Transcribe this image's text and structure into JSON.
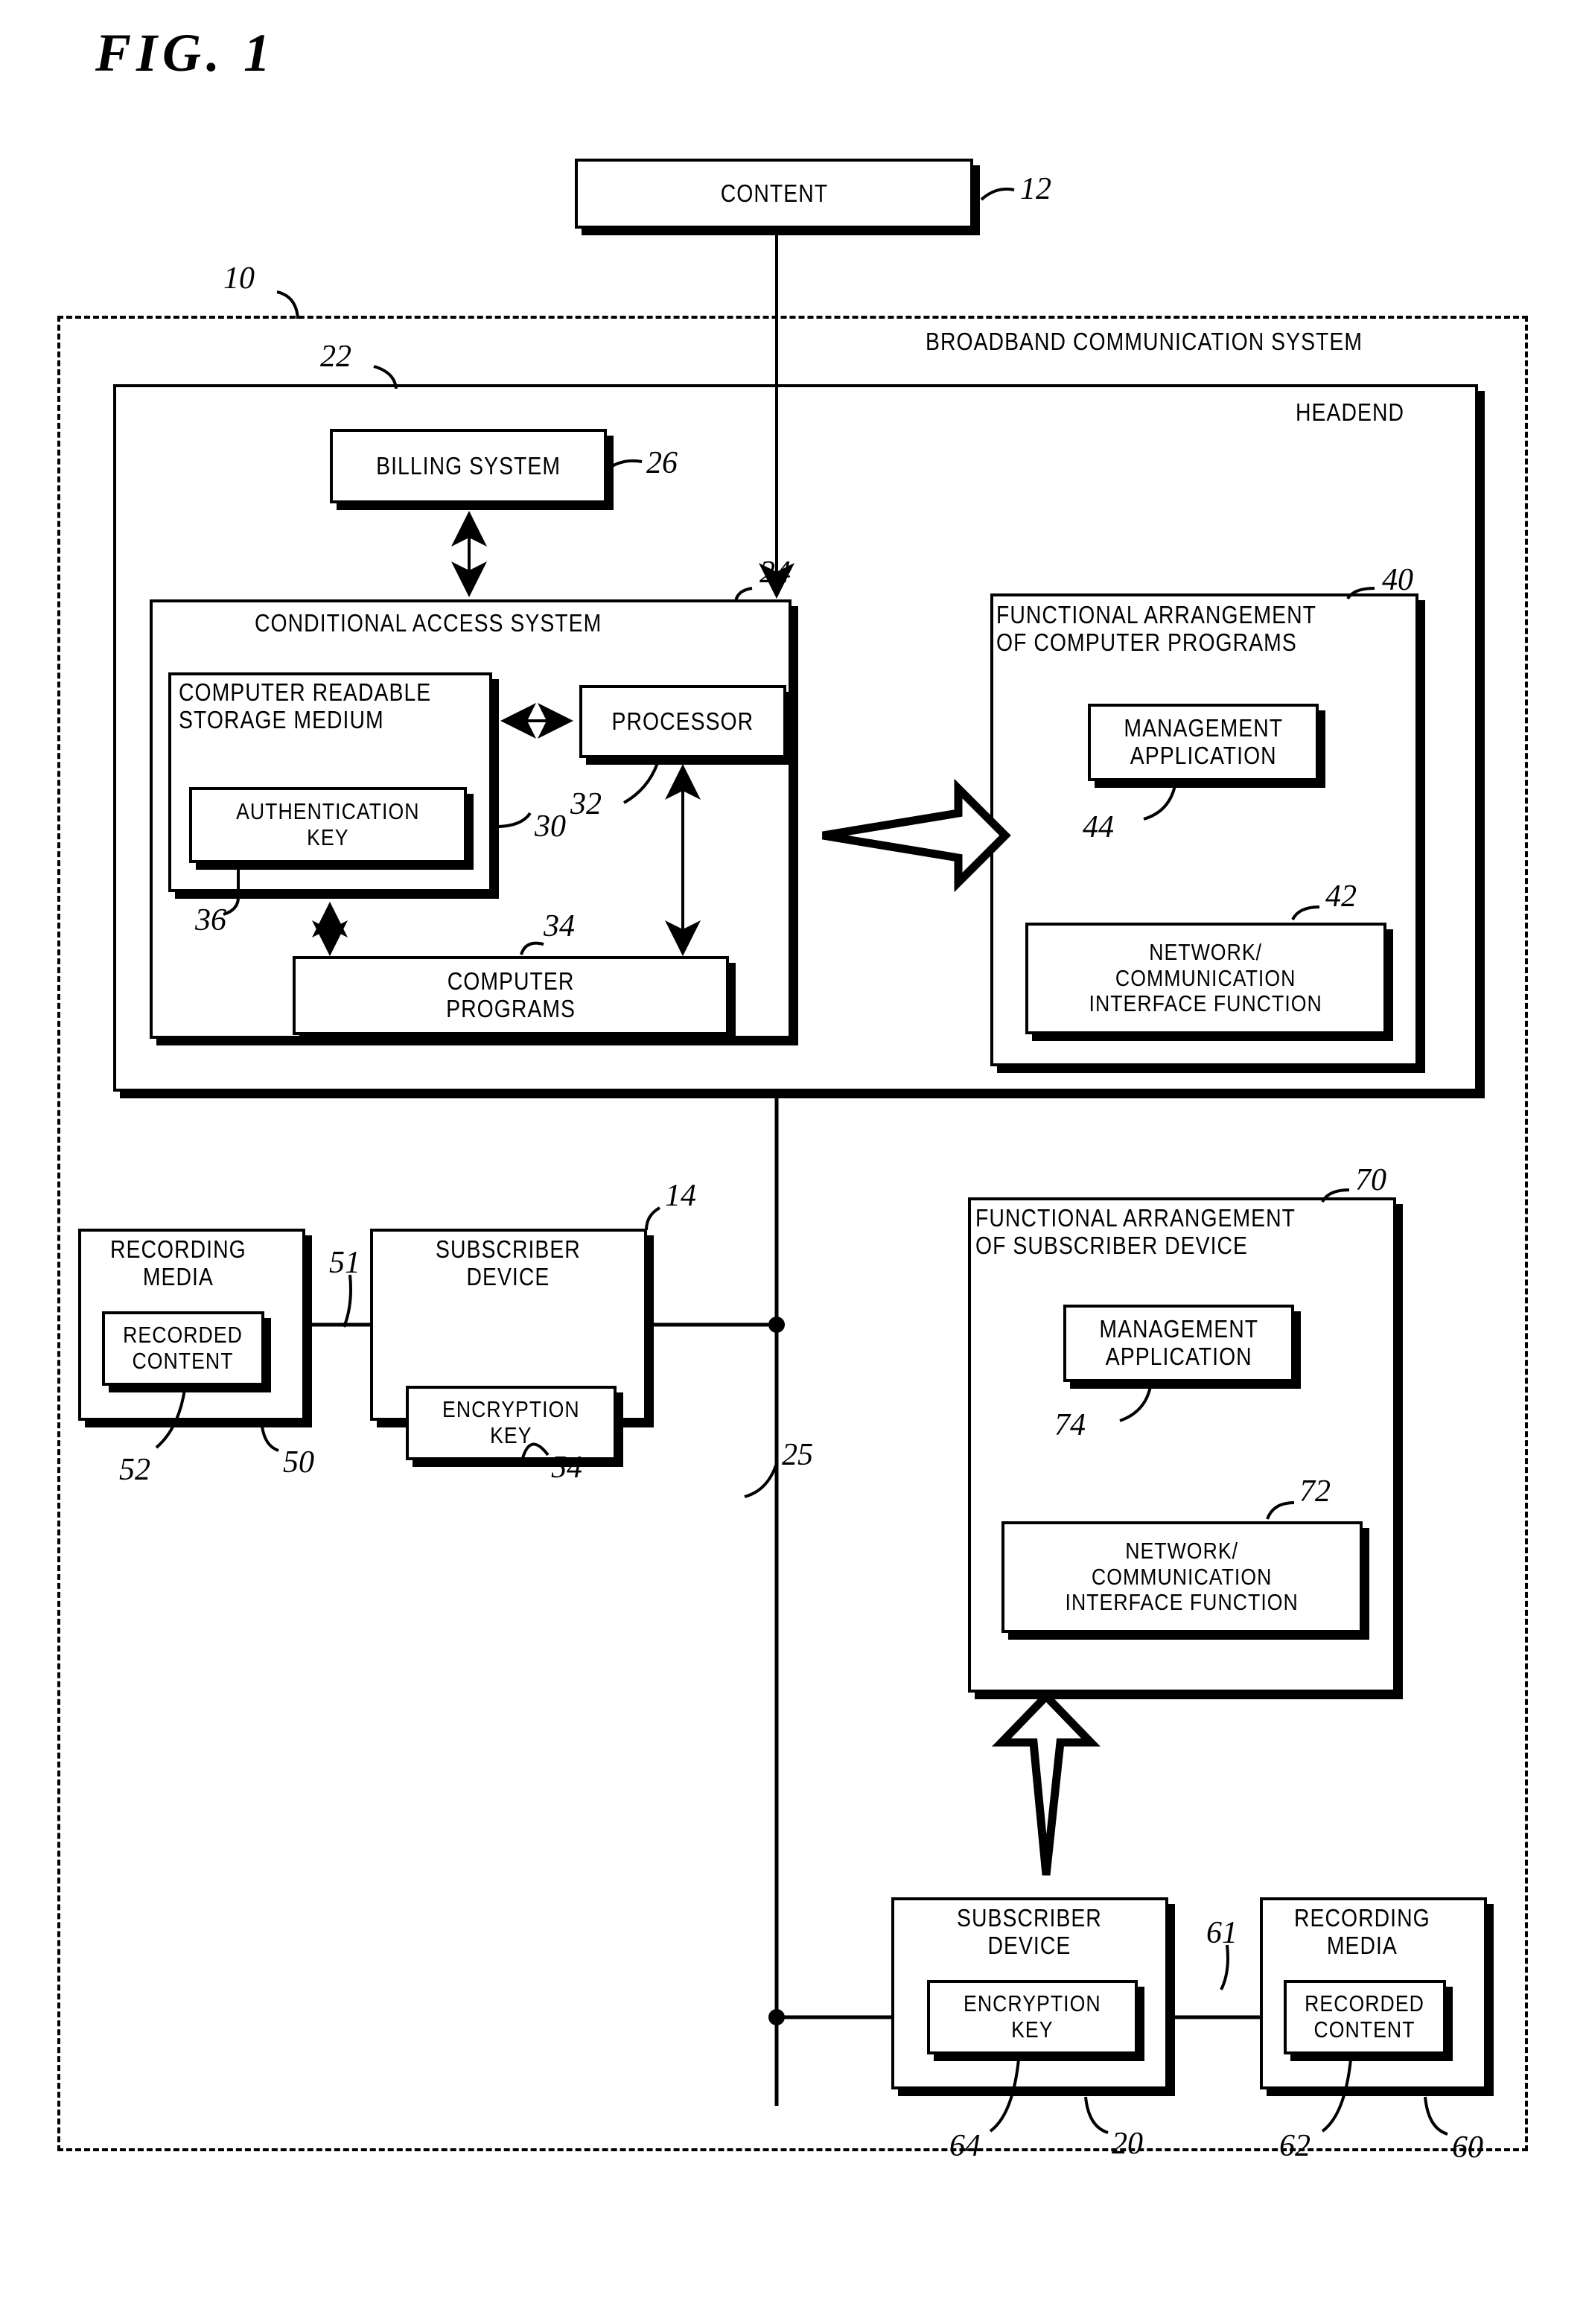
{
  "figure": {
    "title": "FIG. 1"
  },
  "boxes": {
    "content": {
      "label": "CONTENT",
      "ref": "12"
    },
    "system_boundary": {
      "label": "BROADBAND COMMUNICATION SYSTEM",
      "ref": "10"
    },
    "headend": {
      "label": "HEADEND",
      "ref": "22"
    },
    "billing_system": {
      "label": "BILLING SYSTEM",
      "ref": "26"
    },
    "conditional_access_system": {
      "label": "CONDITIONAL ACCESS SYSTEM",
      "ref": "24"
    },
    "computer_readable_storage_medium": {
      "label": "COMPUTER READABLE\nSTORAGE MEDIUM",
      "ref": "30"
    },
    "authentication_key": {
      "label": "AUTHENTICATION\nKEY",
      "ref": "36"
    },
    "processor": {
      "label": "PROCESSOR",
      "ref": "32"
    },
    "computer_programs": {
      "label": "COMPUTER\nPROGRAMS",
      "ref": "34"
    },
    "functional_arrangement_programs": {
      "label": "FUNCTIONAL ARRANGEMENT\nOF COMPUTER PROGRAMS",
      "ref": "40"
    },
    "management_application_headend": {
      "label": "MANAGEMENT\nAPPLICATION",
      "ref": "44"
    },
    "network_interface_headend": {
      "label": "NETWORK/\nCOMMUNICATION\nINTERFACE FUNCTION",
      "ref": "42"
    },
    "recording_media_left": {
      "label": "RECORDING\nMEDIA",
      "ref": "50"
    },
    "recorded_content_left": {
      "label": "RECORDED\nCONTENT",
      "ref": "52"
    },
    "subscriber_device_left": {
      "label": "SUBSCRIBER\nDEVICE",
      "ref": "14"
    },
    "encryption_key_left": {
      "label": "ENCRYPTION\nKEY",
      "ref": "54"
    },
    "link_left": {
      "ref": "51"
    },
    "network_trunk": {
      "ref": "25"
    },
    "functional_arrangement_subscriber": {
      "label": "FUNCTIONAL ARRANGEMENT\nOF SUBSCRIBER DEVICE",
      "ref": "70"
    },
    "management_application_subscriber": {
      "label": "MANAGEMENT\nAPPLICATION",
      "ref": "74"
    },
    "network_interface_subscriber": {
      "label": "NETWORK/\nCOMMUNICATION\nINTERFACE FUNCTION",
      "ref": "72"
    },
    "subscriber_device_bottom": {
      "label": "SUBSCRIBER\nDEVICE",
      "ref": "20"
    },
    "encryption_key_bottom": {
      "label": "ENCRYPTION\nKEY",
      "ref": "64"
    },
    "recording_media_bottom": {
      "label": "RECORDING\nMEDIA",
      "ref": "60"
    },
    "recorded_content_bottom": {
      "label": "RECORDED\nCONTENT",
      "ref": "62"
    },
    "link_bottom": {
      "ref": "61"
    }
  }
}
